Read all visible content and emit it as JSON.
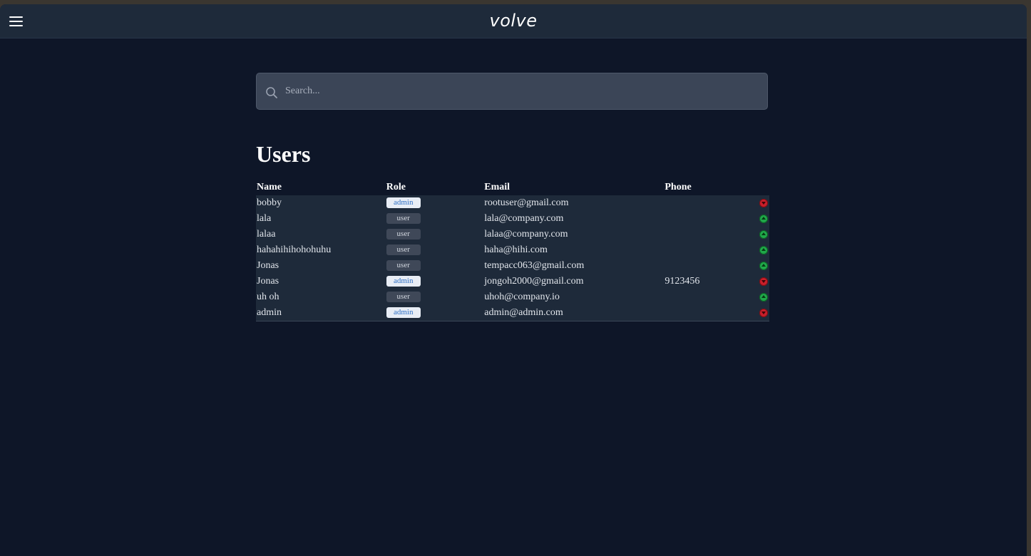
{
  "app": {
    "logo": "volve"
  },
  "search": {
    "placeholder": "Search..."
  },
  "page": {
    "title": "Users"
  },
  "table": {
    "headers": {
      "name": "Name",
      "role": "Role",
      "email": "Email",
      "phone": "Phone"
    },
    "rows": [
      {
        "name": "bobby",
        "role": "admin",
        "email": "rootuser@gmail.com",
        "phone": "",
        "action": "demote"
      },
      {
        "name": "lala",
        "role": "user",
        "email": "lala@company.com",
        "phone": "",
        "action": "promote"
      },
      {
        "name": "lalaa",
        "role": "user",
        "email": "lalaa@company.com",
        "phone": "",
        "action": "promote"
      },
      {
        "name": "hahahihihohohuhu",
        "role": "user",
        "email": "haha@hihi.com",
        "phone": "",
        "action": "promote"
      },
      {
        "name": "Jonas",
        "role": "user",
        "email": "tempacc063@gmail.com",
        "phone": "",
        "action": "promote"
      },
      {
        "name": "Jonas",
        "role": "admin",
        "email": "jongoh2000@gmail.com",
        "phone": "9123456",
        "action": "demote"
      },
      {
        "name": "uh oh",
        "role": "user",
        "email": "uhoh@company.io",
        "phone": "",
        "action": "promote"
      },
      {
        "name": "admin",
        "role": "admin",
        "email": "admin@admin.com",
        "phone": "",
        "action": "demote"
      }
    ]
  },
  "colors": {
    "background": "#0e1628",
    "topbar": "#1e2a3a",
    "admin_badge_text": "#2e6fc4",
    "promote": "#20a84a",
    "demote": "#c81f2a"
  },
  "icons": {
    "menu": "hamburger-menu-icon",
    "search": "search-icon",
    "promote": "arrow-up-circle-icon",
    "demote": "arrow-down-circle-icon"
  }
}
